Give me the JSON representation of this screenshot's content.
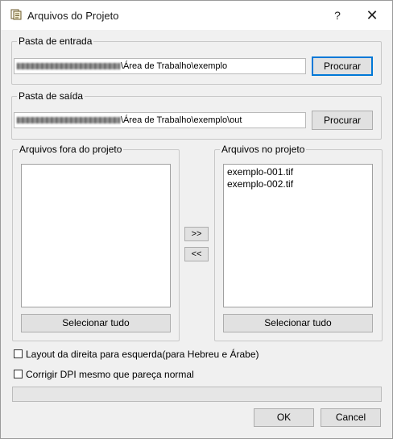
{
  "window": {
    "title": "Arquivos do Projeto",
    "help_label": "?",
    "close_label": "✕"
  },
  "input_group": {
    "label": "Pasta de entrada",
    "path_visible": "\\Área de Trabalho\\exemplo",
    "browse_label": "Procurar"
  },
  "output_group": {
    "label": "Pasta de saída",
    "path_visible": "\\Área de Trabalho\\exemplo\\out",
    "browse_label": "Procurar"
  },
  "left_list": {
    "label": "Arquivos fora do projeto",
    "items": [],
    "select_all_label": "Selecionar tudo"
  },
  "transfer": {
    "add_label": ">>",
    "remove_label": "<<"
  },
  "right_list": {
    "label": "Arquivos no projeto",
    "items": [
      "exemplo-001.tif",
      "exemplo-002.tif"
    ],
    "select_all_label": "Selecionar tudo"
  },
  "options": {
    "rtl_label": "Layout da direita para esquerda(para Hebreu e Árabe)",
    "rtl_checked": false,
    "dpi_label": "Corrigir DPI mesmo que pareça normal",
    "dpi_checked": false
  },
  "progress": {
    "value": 0
  },
  "footer": {
    "ok_label": "OK",
    "cancel_label": "Cancel"
  },
  "colors": {
    "focus_border": "#0078d7"
  }
}
